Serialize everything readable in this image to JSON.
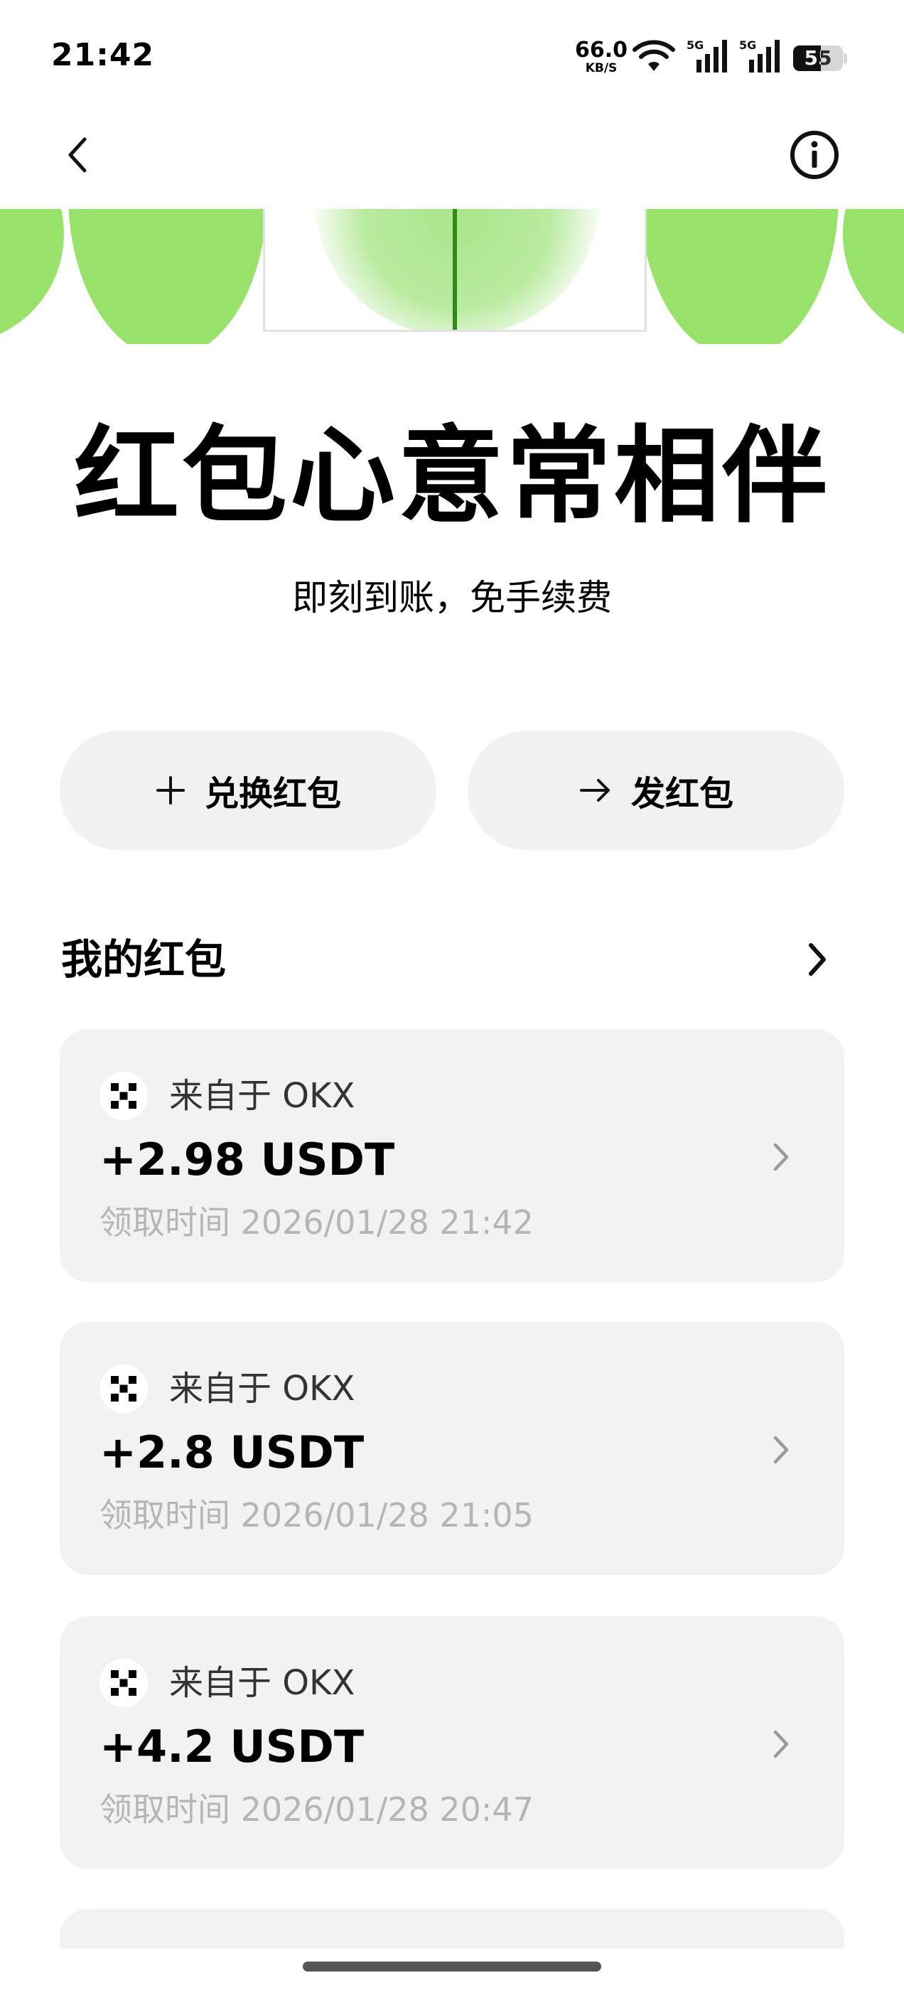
{
  "status_bar": {
    "time": "21:42",
    "net_speed": "66.0",
    "net_speed_unit": "KB/S",
    "signal_label_1": "5G",
    "signal_label_2": "5G",
    "battery": "55",
    "battery_level": 0.55
  },
  "icons": {
    "back": "chevron-left-icon",
    "info": "info-circle-icon",
    "plus": "plus-icon",
    "arrow": "arrow-right-icon",
    "chevron": "chevron-right-icon",
    "okx_logo": "okx-logo-icon"
  },
  "colors": {
    "banner_green": "#97e36a",
    "seam_green": "#2f8a17",
    "card_bg": "#f2f2f2",
    "button_bg": "#f1f1f1"
  },
  "hero": {
    "title": "红包心意常相伴",
    "subtitle": "即刻到账，免手续费"
  },
  "actions": {
    "redeem_label": "兑换红包",
    "send_label": "发红包"
  },
  "my_red_packets": {
    "title": "我的红包",
    "items": [
      {
        "source": "来自于 OKX",
        "amount": "+2.98 USDT",
        "time": "领取时间 2026/01/28 21:42"
      },
      {
        "source": "来自于 OKX",
        "amount": "+2.8 USDT",
        "time": "领取时间 2026/01/28 21:05"
      },
      {
        "source": "来自于 OKX",
        "amount": "+4.2 USDT",
        "time": "领取时间 2026/01/28 20:47"
      }
    ]
  }
}
